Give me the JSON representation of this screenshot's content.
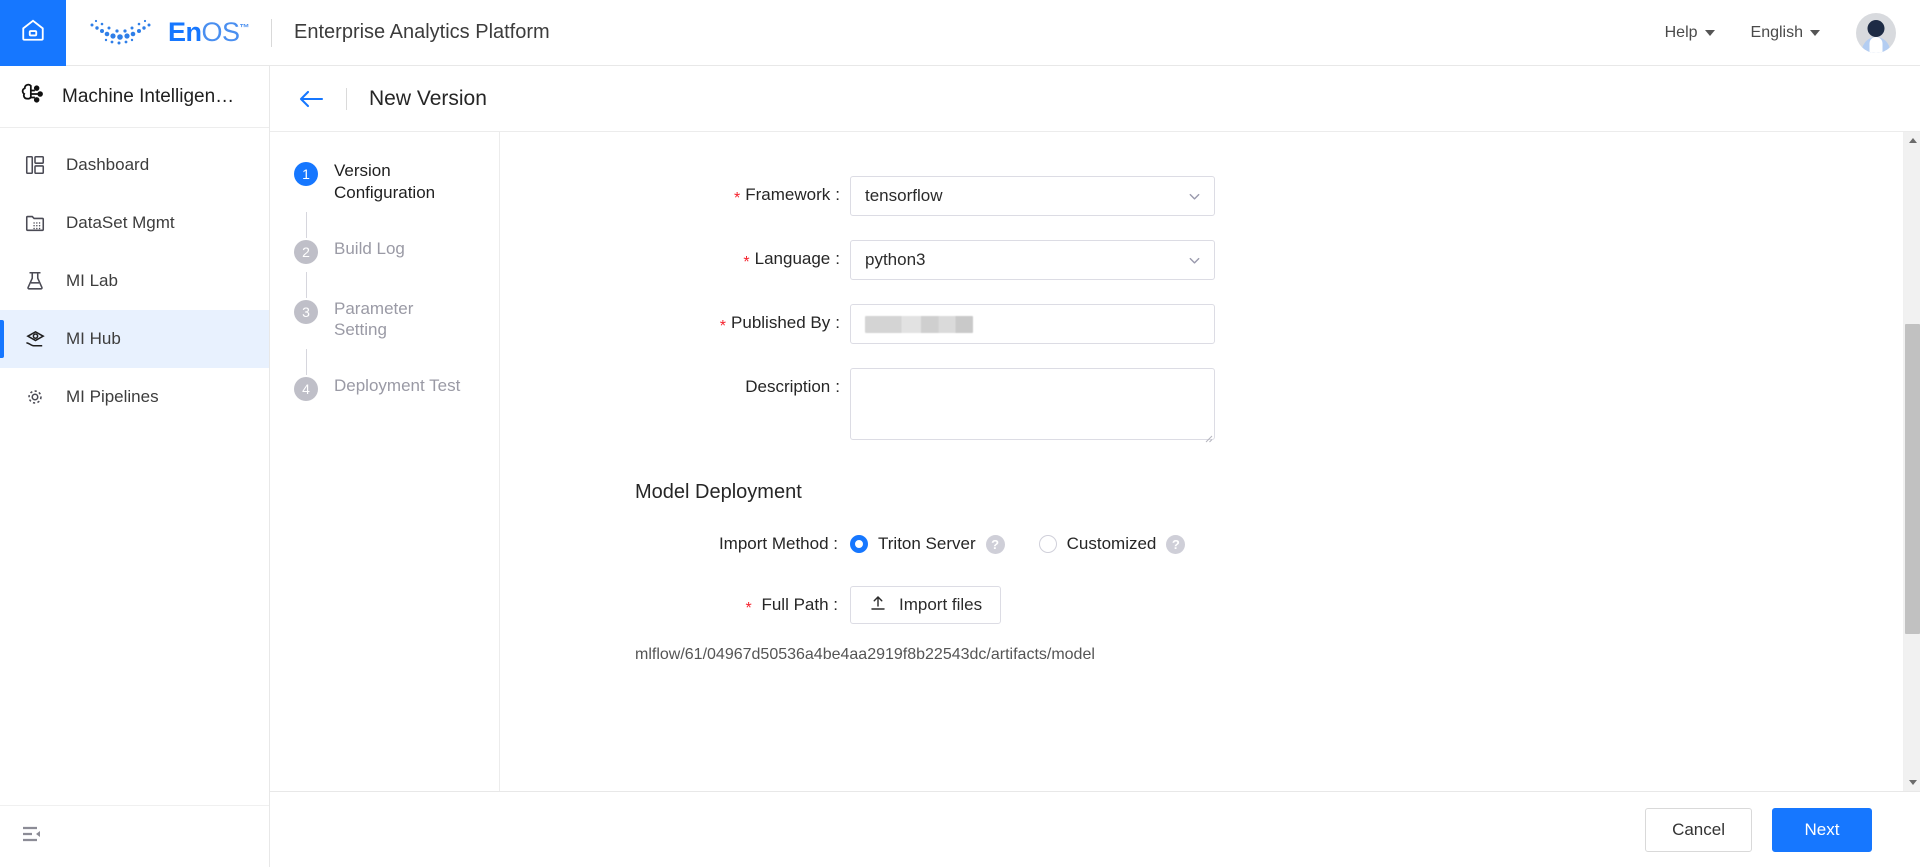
{
  "header": {
    "home_icon": "home-icon",
    "brand_en": "En",
    "brand_os": "OS",
    "brand_tm": "™",
    "platform_title": "Enterprise Analytics Platform",
    "help_label": "Help",
    "language_label": "English",
    "avatar_alt": "user-avatar"
  },
  "sidebar": {
    "app_name": "Machine Intelligen…",
    "items": [
      {
        "label": "Dashboard",
        "icon": "dashboard-icon",
        "active": false
      },
      {
        "label": "DataSet Mgmt",
        "icon": "dataset-icon",
        "active": false
      },
      {
        "label": "MI Lab",
        "icon": "flask-icon",
        "active": false
      },
      {
        "label": "MI Hub",
        "icon": "hub-icon",
        "active": true
      },
      {
        "label": "MI Pipelines",
        "icon": "pipeline-icon",
        "active": false
      }
    ],
    "collapse_icon": "collapse-sidebar-icon"
  },
  "page": {
    "back_icon": "back-arrow-icon",
    "title": "New Version"
  },
  "steps": [
    {
      "num": "1",
      "label": "Version Configuration",
      "active": true
    },
    {
      "num": "2",
      "label": "Build Log",
      "active": false
    },
    {
      "num": "3",
      "label": "Parameter Setting",
      "active": false
    },
    {
      "num": "4",
      "label": "Deployment Test",
      "active": false
    }
  ],
  "form": {
    "framework": {
      "label": "Framework",
      "required": true,
      "value": "tensorflow",
      "chevron": "chevron-down-icon"
    },
    "language": {
      "label": "Language",
      "required": true,
      "value": "python3",
      "chevron": "chevron-down-icon"
    },
    "published_by": {
      "label": "Published By",
      "required": true,
      "value": "",
      "redacted": true
    },
    "description": {
      "label": "Description",
      "required": false,
      "value": "",
      "placeholder": ""
    }
  },
  "deployment": {
    "section_title": "Model Deployment",
    "import_method": {
      "label": "Import Method",
      "options": [
        {
          "label": "Triton Server",
          "selected": true,
          "help": "?"
        },
        {
          "label": "Customized",
          "selected": false,
          "help": "?"
        }
      ]
    },
    "full_path": {
      "label": "Full Path",
      "required": true,
      "button_label": "Import files",
      "button_icon": "upload-icon",
      "path_value": "mlflow/61/04967d50536a4be4aa2919f8b22543dc/artifacts/model"
    }
  },
  "footer": {
    "cancel_label": "Cancel",
    "next_label": "Next"
  },
  "colors": {
    "accent": "#1677ff",
    "active_nav_bg": "#e8f1fe",
    "required_star": "#f5222d",
    "muted_text": "#9a9aa5",
    "border": "#dcdce4"
  }
}
